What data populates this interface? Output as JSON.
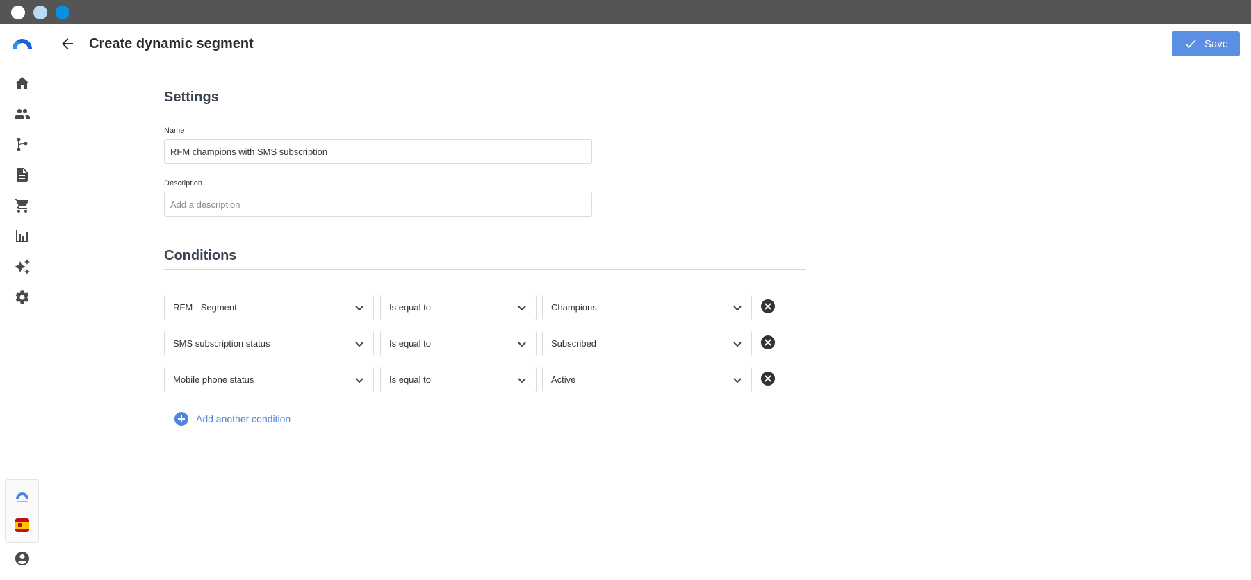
{
  "header": {
    "title": "Create dynamic segment",
    "save_label": "Save"
  },
  "settings": {
    "title": "Settings",
    "name_label": "Name",
    "name_value": "RFM champions with SMS subscription",
    "description_label": "Description",
    "description_placeholder": "Add a description"
  },
  "conditions": {
    "title": "Conditions",
    "rows": [
      {
        "field": "RFM - Segment",
        "operator": "Is equal to",
        "value": "Champions"
      },
      {
        "field": "SMS subscription status",
        "operator": "Is equal to",
        "value": "Subscribed"
      },
      {
        "field": "Mobile phone status",
        "operator": "Is equal to",
        "value": "Active"
      }
    ],
    "add_label": "Add another condition"
  },
  "sidebar": {
    "items": [
      "home-icon",
      "people-icon",
      "flow-icon",
      "document-icon",
      "cart-icon",
      "bar-chart-icon",
      "sparkle-icon",
      "gear-icon"
    ]
  },
  "colors": {
    "accent": "#5b8fe3",
    "link": "#4f86dc",
    "titlebar": "#555555"
  }
}
